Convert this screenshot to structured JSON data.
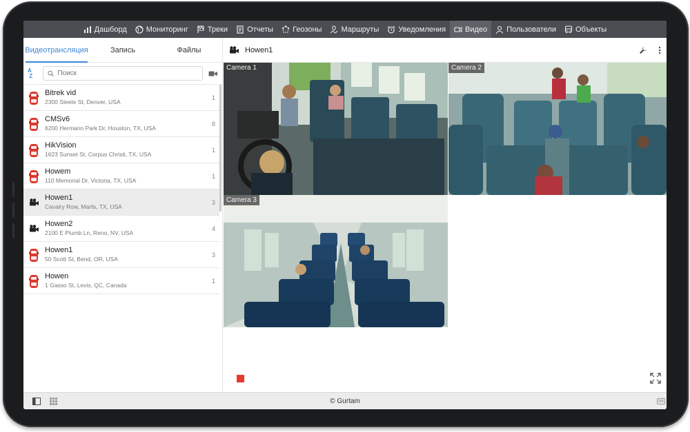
{
  "nav": [
    {
      "label": "Дашборд",
      "icon": "bar-chart-icon"
    },
    {
      "label": "Мониторинг",
      "icon": "globe-icon"
    },
    {
      "label": "Треки",
      "icon": "flag-icon"
    },
    {
      "label": "Отчеты",
      "icon": "document-icon"
    },
    {
      "label": "Геозоны",
      "icon": "geofence-icon"
    },
    {
      "label": "Маршруты",
      "icon": "route-icon"
    },
    {
      "label": "Уведомления",
      "icon": "alarm-clock-icon"
    },
    {
      "label": "Видео",
      "icon": "video-icon"
    },
    {
      "label": "Пользователи",
      "icon": "user-icon"
    },
    {
      "label": "Объекты",
      "icon": "bus-icon"
    }
  ],
  "nav_active": "Видео",
  "left": {
    "tabs": [
      "Видеотрансляция",
      "Запись",
      "Файлы"
    ],
    "active_tab": 0,
    "search_placeholder": "Поиск",
    "units": [
      {
        "name": "Bitrek vid",
        "address": "2300 Steele St, Denver, USA",
        "count": "1",
        "icon": "red-car-icon"
      },
      {
        "name": "CMSv6",
        "address": "6200 Hermann Park Dr, Houston, TX, USA",
        "count": "8",
        "icon": "red-car-icon"
      },
      {
        "name": "HikVision",
        "address": "1623 Sunset St, Corpus Christi, TX, USA",
        "count": "1",
        "icon": "red-car-icon"
      },
      {
        "name": "Howem",
        "address": "110 Memorial Dr, Victoria, TX, USA",
        "count": "1",
        "icon": "red-car-icon"
      },
      {
        "name": "Howen1",
        "address": "Cavalry Row, Marfa, TX, USA",
        "count": "3",
        "icon": "video-camera-icon",
        "selected": true
      },
      {
        "name": "Howen2",
        "address": "2100 E Plumb Ln, Reno, NV, USA",
        "count": "4",
        "icon": "video-camera-icon"
      },
      {
        "name": "Howen1",
        "address": "50 Scott St, Bend, OR, USA",
        "count": "3",
        "icon": "red-car-icon"
      },
      {
        "name": "Howen",
        "address": "1 Gasso St, Levis, QC, Canada",
        "count": "1",
        "icon": "red-car-icon"
      }
    ]
  },
  "right": {
    "title": "Howen1",
    "cameras": [
      "Camera 1",
      "Camera 2",
      "Camera 3"
    ]
  },
  "footer": {
    "copyright": "© Gurtam"
  },
  "colors": {
    "accent": "#3f87d6",
    "nav_bg": "#4a4d52",
    "record": "#e8382e"
  }
}
